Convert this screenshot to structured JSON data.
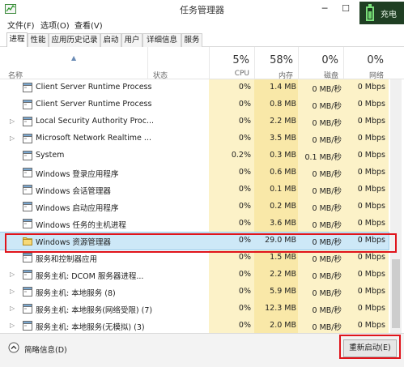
{
  "window": {
    "title": "任务管理器"
  },
  "overlay": {
    "label": "充电"
  },
  "menu": [
    "文件(F)",
    "选项(O)",
    "查看(V)"
  ],
  "tabs": [
    "进程",
    "性能",
    "应用历史记录",
    "启动",
    "用户",
    "详细信息",
    "服务"
  ],
  "active_tab": 0,
  "columns": {
    "name": "名称",
    "status": "状态",
    "cpu": {
      "percent": "5%",
      "label": "CPU"
    },
    "mem": {
      "percent": "58%",
      "label": "内存"
    },
    "disk": {
      "percent": "0%",
      "label": "磁盘"
    },
    "net": {
      "percent": "0%",
      "label": "网络"
    }
  },
  "processes": [
    {
      "name": "Client Server Runtime Process",
      "expandable": false,
      "cpu": "0%",
      "mem": "1.4 MB",
      "disk": "0 MB/秒",
      "net": "0 Mbps"
    },
    {
      "name": "Client Server Runtime Process",
      "expandable": false,
      "cpu": "0%",
      "mem": "0.8 MB",
      "disk": "0 MB/秒",
      "net": "0 Mbps"
    },
    {
      "name": "Local Security Authority Proc...",
      "expandable": true,
      "cpu": "0%",
      "mem": "2.2 MB",
      "disk": "0 MB/秒",
      "net": "0 Mbps"
    },
    {
      "name": "Microsoft Network Realtime ...",
      "expandable": true,
      "cpu": "0%",
      "mem": "3.5 MB",
      "disk": "0 MB/秒",
      "net": "0 Mbps"
    },
    {
      "name": "System",
      "expandable": false,
      "cpu": "0.2%",
      "mem": "0.3 MB",
      "disk": "0.1 MB/秒",
      "net": "0 Mbps"
    },
    {
      "name": "Windows 登录应用程序",
      "expandable": false,
      "cpu": "0%",
      "mem": "0.6 MB",
      "disk": "0 MB/秒",
      "net": "0 Mbps"
    },
    {
      "name": "Windows 会话管理器",
      "expandable": false,
      "cpu": "0%",
      "mem": "0.1 MB",
      "disk": "0 MB/秒",
      "net": "0 Mbps"
    },
    {
      "name": "Windows 启动应用程序",
      "expandable": false,
      "cpu": "0%",
      "mem": "0.2 MB",
      "disk": "0 MB/秒",
      "net": "0 Mbps"
    },
    {
      "name": "Windows 任务的主机进程",
      "expandable": false,
      "cpu": "0%",
      "mem": "3.6 MB",
      "disk": "0 MB/秒",
      "net": "0 Mbps"
    },
    {
      "name": "Windows 资源管理器",
      "expandable": false,
      "selected": true,
      "icon": "explorer-folder",
      "cpu": "0%",
      "mem": "29.0 MB",
      "disk": "0 MB/秒",
      "net": "0 Mbps"
    },
    {
      "name": "服务和控制器应用",
      "expandable": false,
      "cpu": "0%",
      "mem": "1.5 MB",
      "disk": "0 MB/秒",
      "net": "0 Mbps"
    },
    {
      "name": "服务主机: DCOM 服务器进程...",
      "expandable": true,
      "cpu": "0%",
      "mem": "2.2 MB",
      "disk": "0 MB/秒",
      "net": "0 Mbps"
    },
    {
      "name": "服务主机: 本地服务 (8)",
      "expandable": true,
      "cpu": "0%",
      "mem": "5.9 MB",
      "disk": "0 MB/秒",
      "net": "0 Mbps"
    },
    {
      "name": "服务主机: 本地服务(网络受限) (7)",
      "expandable": true,
      "cpu": "0%",
      "mem": "12.3 MB",
      "disk": "0 MB/秒",
      "net": "0 Mbps"
    },
    {
      "name": "服务主机: 本地服务(无模拟) (3)",
      "expandable": true,
      "cpu": "0%",
      "mem": "2.0 MB",
      "disk": "0 MB/秒",
      "net": "0 Mbps"
    }
  ],
  "footer": {
    "fewer_details": "简略信息(D)",
    "restart": "重新启动(E)"
  },
  "colors": {
    "cpu_band": "#fcf2c8",
    "mem_band": "#f9e8a8",
    "disk_band": "#fcf2c8",
    "net_band": "#fcf2c8",
    "selection": "#cde8f7",
    "highlight": "#e0141b"
  }
}
